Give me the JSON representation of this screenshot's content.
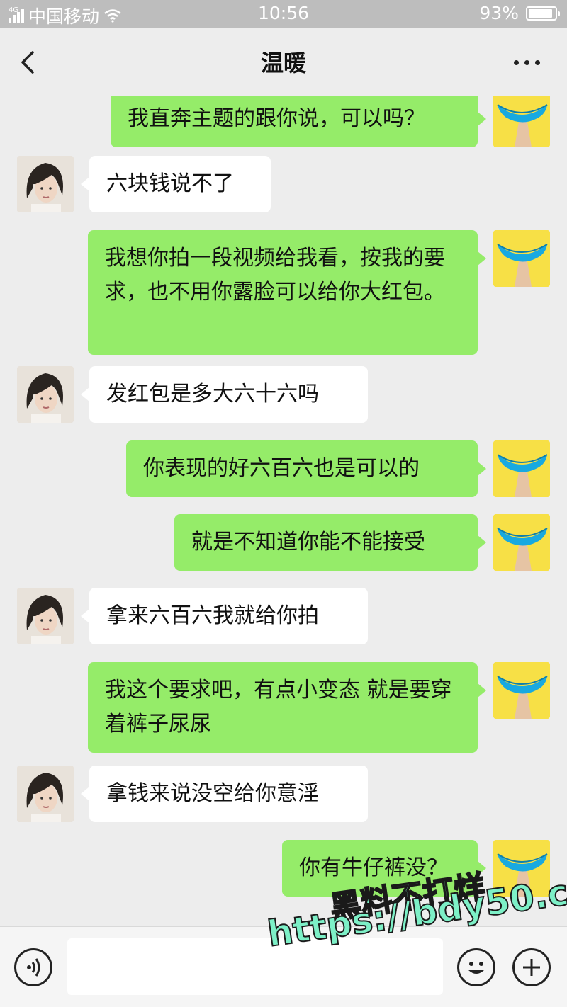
{
  "status": {
    "carrier": "中国移动",
    "network": "4G",
    "time": "10:56",
    "battery": "93%",
    "battery_level": 0.93
  },
  "header": {
    "title": "温暖"
  },
  "messages": [
    {
      "from": "me",
      "text": "我直奔主题的跟你说，可以吗？"
    },
    {
      "from": "her",
      "text": "六块钱说不了"
    },
    {
      "from": "me",
      "text": "我想你拍一段视频给我看，按我的要求，也不用你露脸可以给你大红包。"
    },
    {
      "from": "her",
      "text": "发红包是多大六十六吗"
    },
    {
      "from": "me",
      "text": "你表现的好六百六也是可以的"
    },
    {
      "from": "me",
      "text": "就是不知道你能不能接受"
    },
    {
      "from": "her",
      "text": "拿来六百六我就给你拍"
    },
    {
      "from": "me",
      "text": "我这个要求吧，有点小变态 就是要穿着裤子尿尿"
    },
    {
      "from": "her",
      "text": "拿钱来说没空给你意淫"
    },
    {
      "from": "me",
      "text": "你有牛仔裤没？"
    }
  ],
  "watermark": {
    "line1": "黑料不打烊",
    "line2": "https://bdy50.co"
  },
  "icons": {
    "back": "chevron-left-icon",
    "more": "more-dots-icon",
    "voice": "voice-icon",
    "emoji": "emoji-icon",
    "plus": "plus-icon"
  },
  "colors": {
    "my_bubble": "#95ec69",
    "her_bubble": "#ffffff",
    "background": "#ededed"
  }
}
